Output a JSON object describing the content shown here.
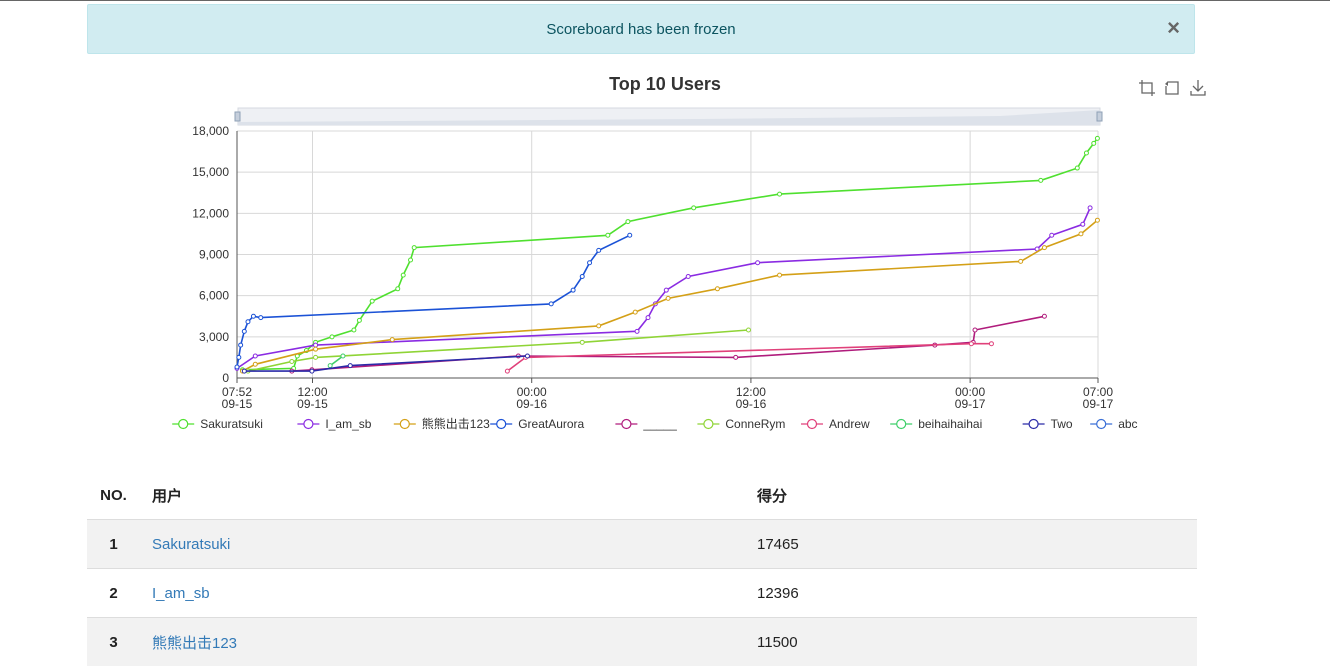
{
  "alert": {
    "message": "Scoreboard has been frozen",
    "close_label": "×"
  },
  "chart_data": {
    "type": "line",
    "title": "Top 10 Users",
    "ylim": [
      0,
      18000
    ],
    "y_ticks": [
      0,
      3000,
      6000,
      9000,
      12000,
      15000,
      18000
    ],
    "y_tick_labels": [
      "0",
      "3,000",
      "6,000",
      "9,000",
      "12,000",
      "15,000",
      "18,000"
    ],
    "x_range": [
      0,
      47.133
    ],
    "x_ticks": [
      {
        "x": 0,
        "l1": "07:52",
        "l2": "09-15"
      },
      {
        "x": 4.133,
        "l1": "12:00",
        "l2": "09-15"
      },
      {
        "x": 16.133,
        "l1": "00:00",
        "l2": "09-16"
      },
      {
        "x": 28.133,
        "l1": "12:00",
        "l2": "09-16"
      },
      {
        "x": 40.133,
        "l1": "00:00",
        "l2": "09-17"
      },
      {
        "x": 47.133,
        "l1": "07:00",
        "l2": "09-17"
      }
    ],
    "grid": true,
    "legend_position": "bottom",
    "toolbox": [
      "zoom-icon",
      "restore-icon",
      "download-icon"
    ],
    "series": [
      {
        "name": "Sakuratsuki",
        "color": "#4fe02f",
        "points": [
          [
            0.3,
            600
          ],
          [
            3.1,
            700
          ],
          [
            3.3,
            1600
          ],
          [
            3.8,
            2000
          ],
          [
            4.3,
            2600
          ],
          [
            5.2,
            3000
          ],
          [
            6.4,
            3500
          ],
          [
            6.7,
            4200
          ],
          [
            7.4,
            5600
          ],
          [
            8.8,
            6500
          ],
          [
            9.1,
            7500
          ],
          [
            9.5,
            8600
          ],
          [
            9.7,
            9500
          ],
          [
            20.3,
            10400
          ],
          [
            21.4,
            11400
          ],
          [
            25.0,
            12400
          ],
          [
            29.7,
            13400
          ],
          [
            44.0,
            14400
          ],
          [
            46.0,
            15300
          ],
          [
            46.5,
            16400
          ],
          [
            46.9,
            17100
          ],
          [
            47.1,
            17465
          ]
        ]
      },
      {
        "name": "I_am_sb",
        "color": "#8a2be2",
        "points": [
          [
            0,
            700
          ],
          [
            1,
            1600
          ],
          [
            4.3,
            2400
          ],
          [
            21.9,
            3400
          ],
          [
            22.5,
            4400
          ],
          [
            22.9,
            5400
          ],
          [
            23.5,
            6400
          ],
          [
            24.7,
            7400
          ],
          [
            28.5,
            8400
          ],
          [
            43.8,
            9400
          ],
          [
            44.6,
            10400
          ],
          [
            46.3,
            11200
          ],
          [
            46.7,
            12396
          ]
        ]
      },
      {
        "name": "熊熊出击123",
        "color": "#d4a017",
        "points": [
          [
            0.3,
            500
          ],
          [
            1,
            1000
          ],
          [
            4.3,
            2100
          ],
          [
            8.5,
            2800
          ],
          [
            19.8,
            3800
          ],
          [
            21.8,
            4800
          ],
          [
            23.6,
            5800
          ],
          [
            26.3,
            6500
          ],
          [
            29.7,
            7500
          ],
          [
            42.9,
            8500
          ],
          [
            44.2,
            9500
          ],
          [
            46.2,
            10500
          ],
          [
            47.1,
            11500
          ]
        ]
      },
      {
        "name": "GreatAurora",
        "color": "#1b52d6",
        "points": [
          [
            0,
            800
          ],
          [
            0.1,
            1500
          ],
          [
            0.2,
            2400
          ],
          [
            0.4,
            3400
          ],
          [
            0.6,
            4100
          ],
          [
            0.9,
            4500
          ],
          [
            1.3,
            4400
          ],
          [
            17.2,
            5400
          ],
          [
            18.4,
            6400
          ],
          [
            18.9,
            7400
          ],
          [
            19.3,
            8400
          ],
          [
            19.8,
            9300
          ],
          [
            21.5,
            10400
          ]
        ]
      },
      {
        "name": "_____",
        "color": "#b01c7c",
        "points": [
          [
            3.0,
            500
          ],
          [
            4.1,
            600
          ],
          [
            15.4,
            1600
          ],
          [
            27.3,
            1500
          ],
          [
            38.2,
            2400
          ],
          [
            40.3,
            2600
          ],
          [
            40.4,
            3500
          ],
          [
            44.2,
            4500
          ]
        ]
      },
      {
        "name": "ConneRym",
        "color": "#8fd436",
        "points": [
          [
            0.6,
            500
          ],
          [
            3.0,
            1200
          ],
          [
            4.3,
            1500
          ],
          [
            18.9,
            2600
          ],
          [
            28.0,
            3500
          ]
        ]
      },
      {
        "name": "Andrew",
        "color": "#e0407a",
        "points": [
          [
            14.8,
            500
          ],
          [
            15.8,
            1500
          ],
          [
            40.2,
            2500
          ],
          [
            41.3,
            2500
          ]
        ]
      },
      {
        "name": "beihaihaihai",
        "color": "#3fcf6a",
        "points": [
          [
            5.1,
            900
          ],
          [
            5.8,
            1600
          ]
        ]
      },
      {
        "name": "Two",
        "color": "#2a2aa8",
        "points": [
          [
            0.4,
            500
          ],
          [
            4.1,
            500
          ],
          [
            6.2,
            900
          ],
          [
            15.9,
            1600
          ]
        ]
      },
      {
        "name": "abc",
        "color": "#3a6fd6",
        "points": []
      }
    ]
  },
  "table": {
    "headers": [
      "NO.",
      "用户",
      "得分"
    ],
    "rows": [
      {
        "rank": "1",
        "user": "Sakuratsuki",
        "score": "17465"
      },
      {
        "rank": "2",
        "user": "I_am_sb",
        "score": "12396"
      },
      {
        "rank": "3",
        "user": "熊熊出击123",
        "score": "11500"
      }
    ]
  }
}
